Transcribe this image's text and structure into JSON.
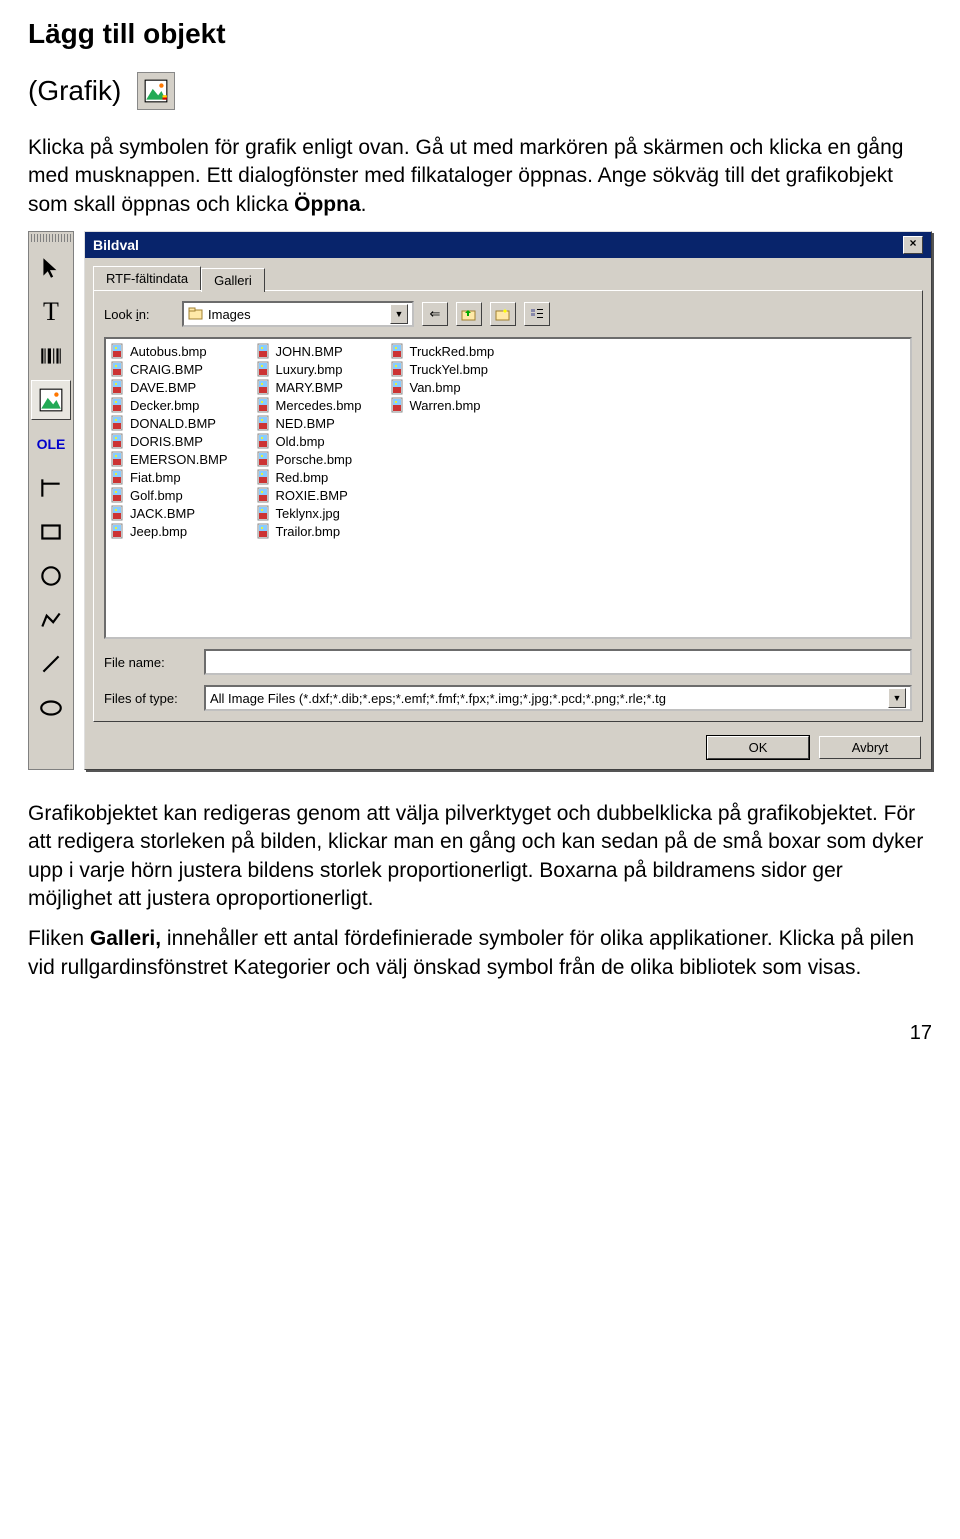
{
  "doc": {
    "heading": "Lägg till objekt",
    "subtitle": "(Grafik)",
    "p1a": "Klicka på symbolen för grafik enligt ovan. Gå ut med markören på skärmen och klicka en gång med musknappen. Ett dialogfönster med filkataloger öppnas. Ange sökväg till det grafikobjekt som skall öppnas och klicka ",
    "p1b": "Öppna",
    "p1c": ".",
    "p2": "Grafikobjektet kan redigeras genom att välja pilverktyget och dubbelklicka på grafikobjektet. För att redigera storleken på bilden, klickar man en gång och kan sedan på de små boxar som dyker upp i varje hörn justera bildens storlek proportionerligt. Boxarna på bildramens sidor ger möjlighet att justera oproportionerligt.",
    "p3a": "Fliken ",
    "p3b": "Galleri,",
    "p3c": " innehåller ett antal fördefinierade symboler för olika applikationer. Klicka på pilen vid rullgardinsfönstret Kategorier och välj önskad symbol från de olika bibliotek som visas.",
    "pagenum": "17"
  },
  "dialog": {
    "title": "Bildval",
    "tab_active": "RTF-fältindata",
    "tab_other": "Galleri",
    "lookin_label_pre": "Look ",
    "lookin_label_ul": "i",
    "lookin_label_post": "n:",
    "lookin_value": "Images",
    "filename_label_pre": "File ",
    "filename_label_ul": "n",
    "filename_label_post": "ame:",
    "filename_value": "",
    "filetype_label_pre": "Files of ",
    "filetype_label_ul": "t",
    "filetype_label_post": "ype:",
    "filetype_value": "All Image Files (*.dxf;*.dib;*.eps;*.emf;*.fmf;*.fpx;*.img;*.jpg;*.pcd;*.png;*.rle;*.tg",
    "ok": "OK",
    "cancel": "Avbryt",
    "files_col1": [
      "Autobus.bmp",
      "CRAIG.BMP",
      "DAVE.BMP",
      "Decker.bmp",
      "DONALD.BMP",
      "DORIS.BMP",
      "EMERSON.BMP",
      "Fiat.bmp",
      "Golf.bmp",
      "JACK.BMP",
      "Jeep.bmp"
    ],
    "files_col2": [
      "JOHN.BMP",
      "Luxury.bmp",
      "MARY.BMP",
      "Mercedes.bmp",
      "NED.BMP",
      "Old.bmp",
      "Porsche.bmp",
      "Red.bmp",
      "ROXIE.BMP",
      "Teklynx.jpg",
      "Trailor.bmp"
    ],
    "files_col3": [
      "TruckRed.bmp",
      "TruckYel.bmp",
      "Van.bmp",
      "Warren.bmp"
    ]
  }
}
